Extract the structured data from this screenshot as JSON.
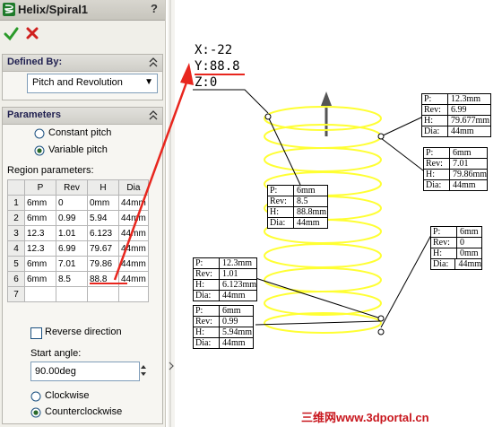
{
  "panel": {
    "title": "Helix/Spiral1",
    "help_label": "?",
    "defined_by": {
      "title": "Defined By:",
      "selected": "Pitch and Revolution"
    },
    "parameters": {
      "title": "Parameters",
      "constant_pitch": "Constant pitch",
      "variable_pitch": "Variable pitch",
      "region_label": "Region parameters:",
      "columns": [
        "P",
        "Rev",
        "H",
        "Dia"
      ],
      "rows": [
        {
          "n": "1",
          "p": "6mm",
          "rev": "0",
          "h": "0mm",
          "dia": "44mm"
        },
        {
          "n": "2",
          "p": "6mm",
          "rev": "0.99",
          "h": "5.94",
          "dia": "44mm"
        },
        {
          "n": "3",
          "p": "12.3",
          "rev": "1.01",
          "h": "6.123",
          "dia": "44mm"
        },
        {
          "n": "4",
          "p": "12.3",
          "rev": "6.99",
          "h": "79.67",
          "dia": "44mm"
        },
        {
          "n": "5",
          "p": "6mm",
          "rev": "7.01",
          "h": "79.86",
          "dia": "44mm"
        },
        {
          "n": "6",
          "p": "6mm",
          "rev": "8.5",
          "h": "88.8",
          "dia": "44mm"
        },
        {
          "n": "7",
          "p": "",
          "rev": "",
          "h": "",
          "dia": ""
        }
      ],
      "reverse_direction": "Reverse direction",
      "start_angle_label": "Start angle:",
      "start_angle_value": "90.00deg",
      "clockwise": "Clockwise",
      "counterclockwise": "Counterclockwise"
    }
  },
  "viewport": {
    "coords": {
      "x": "X:-22",
      "y": "Y:88.8",
      "z": "Z:0"
    },
    "callouts": [
      {
        "rows": [
          [
            "P:",
            "6mm"
          ],
          [
            "Rev:",
            "8.5"
          ],
          [
            "H:",
            "88.8mm"
          ],
          [
            "Dia:",
            "44mm"
          ]
        ]
      },
      {
        "rows": [
          [
            "P:",
            "12.3mm"
          ],
          [
            "Rev:",
            "6.99"
          ],
          [
            "H:",
            "79.677mm"
          ],
          [
            "Dia:",
            "44mm"
          ]
        ]
      },
      {
        "rows": [
          [
            "P:",
            "6mm"
          ],
          [
            "Rev:",
            "7.01"
          ],
          [
            "H:",
            "79.86mm"
          ],
          [
            "Dia:",
            "44mm"
          ]
        ]
      },
      {
        "rows": [
          [
            "P:",
            "6mm"
          ],
          [
            "Rev:",
            "0"
          ],
          [
            "H:",
            "0mm"
          ],
          [
            "Dia:",
            "44mm"
          ]
        ]
      },
      {
        "rows": [
          [
            "P:",
            "12.3mm"
          ],
          [
            "Rev:",
            "1.01"
          ],
          [
            "H:",
            "6.123mm"
          ],
          [
            "Dia:",
            "44mm"
          ]
        ]
      },
      {
        "rows": [
          [
            "P:",
            "6mm"
          ],
          [
            "Rev:",
            "0.99"
          ],
          [
            "H:",
            "5.94mm"
          ],
          [
            "Dia:",
            "44mm"
          ]
        ]
      }
    ],
    "watermark": "三维网www.3dportal.cn"
  },
  "colors": {
    "helix": "#ffff33",
    "highlight": "#e8261e",
    "accent": "#1f1f4f"
  }
}
